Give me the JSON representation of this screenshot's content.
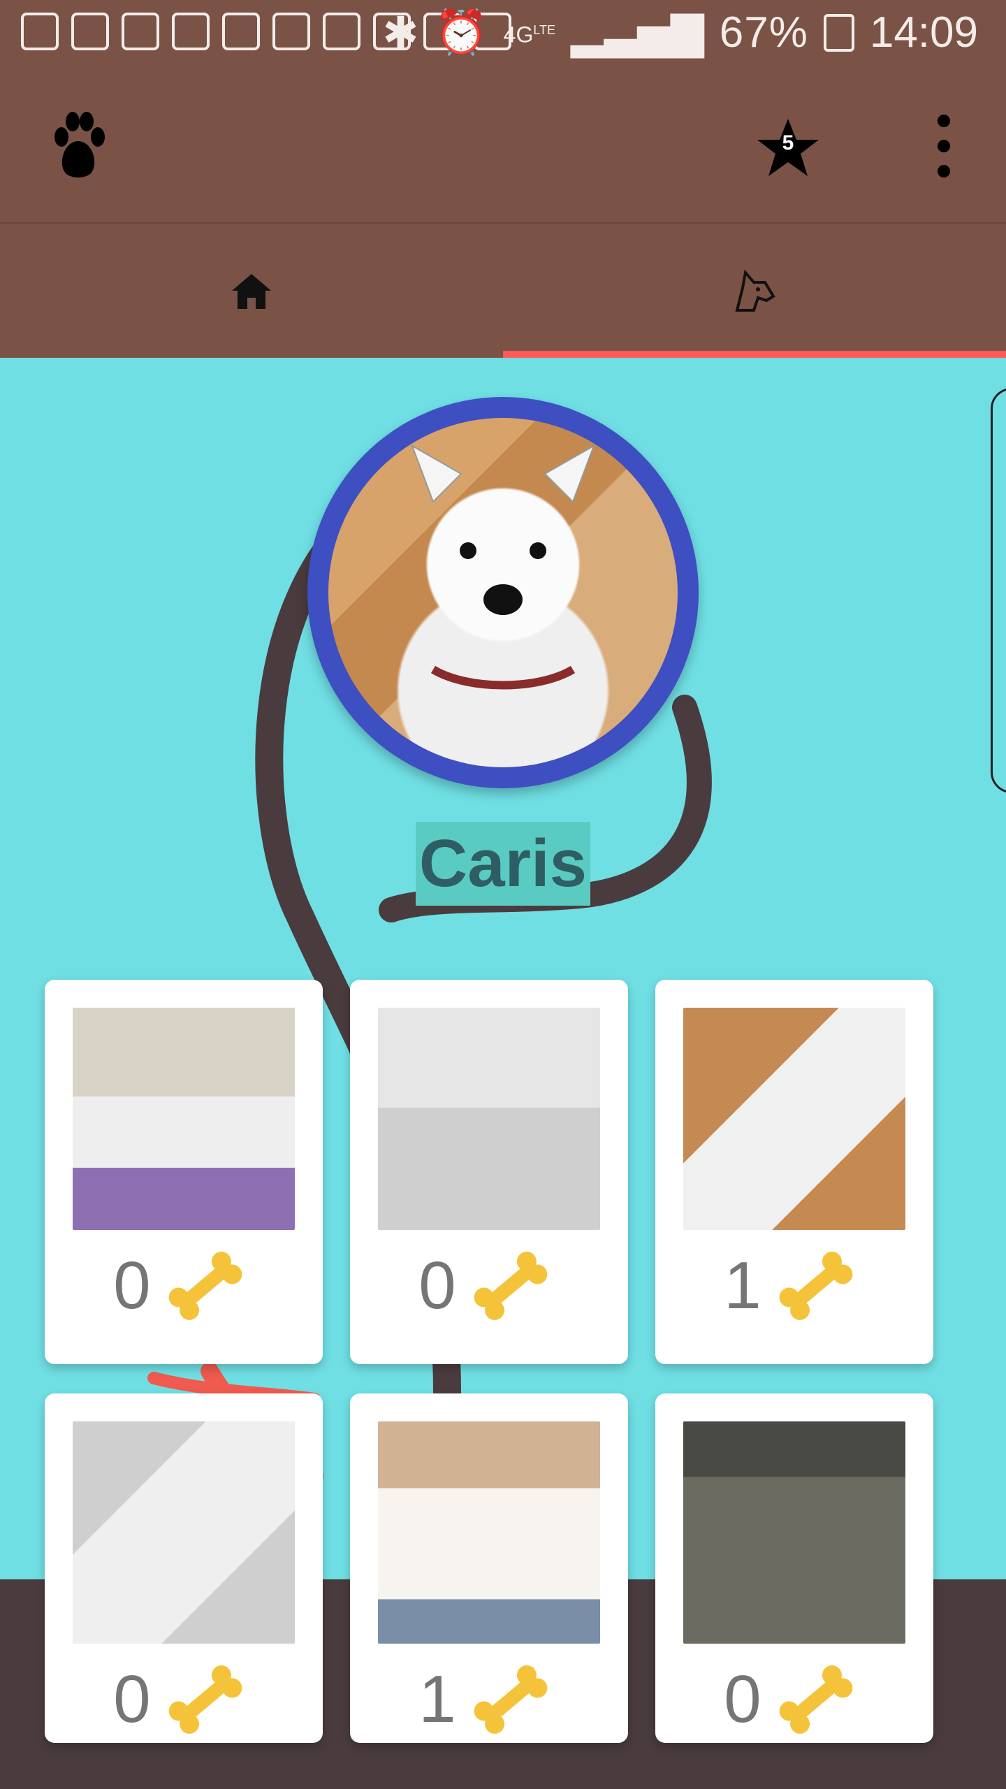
{
  "status_bar": {
    "network": "4G",
    "network_sub": "LTE",
    "battery": "67%",
    "time": "14:09"
  },
  "toolbar": {
    "logo_icon": "paw-icon",
    "favorites_icon": "star-icon",
    "favorites_count": "5",
    "menu_icon": "more-vert-icon"
  },
  "tabs": [
    {
      "name": "home",
      "icon": "home-icon"
    },
    {
      "name": "dog",
      "icon": "dog-head-icon"
    }
  ],
  "profile": {
    "name": "Caris"
  },
  "photos": [
    {
      "likes": "0"
    },
    {
      "likes": "0"
    },
    {
      "likes": "1"
    },
    {
      "likes": "0"
    },
    {
      "likes": "1"
    },
    {
      "likes": "0"
    }
  ],
  "colors": {
    "toolbar": "#7a5346",
    "background": "#6fdfe4",
    "tab_indicator": "#ff5a55",
    "avatar_ring": "#3e4fc2",
    "bone": "#f5c33a"
  }
}
